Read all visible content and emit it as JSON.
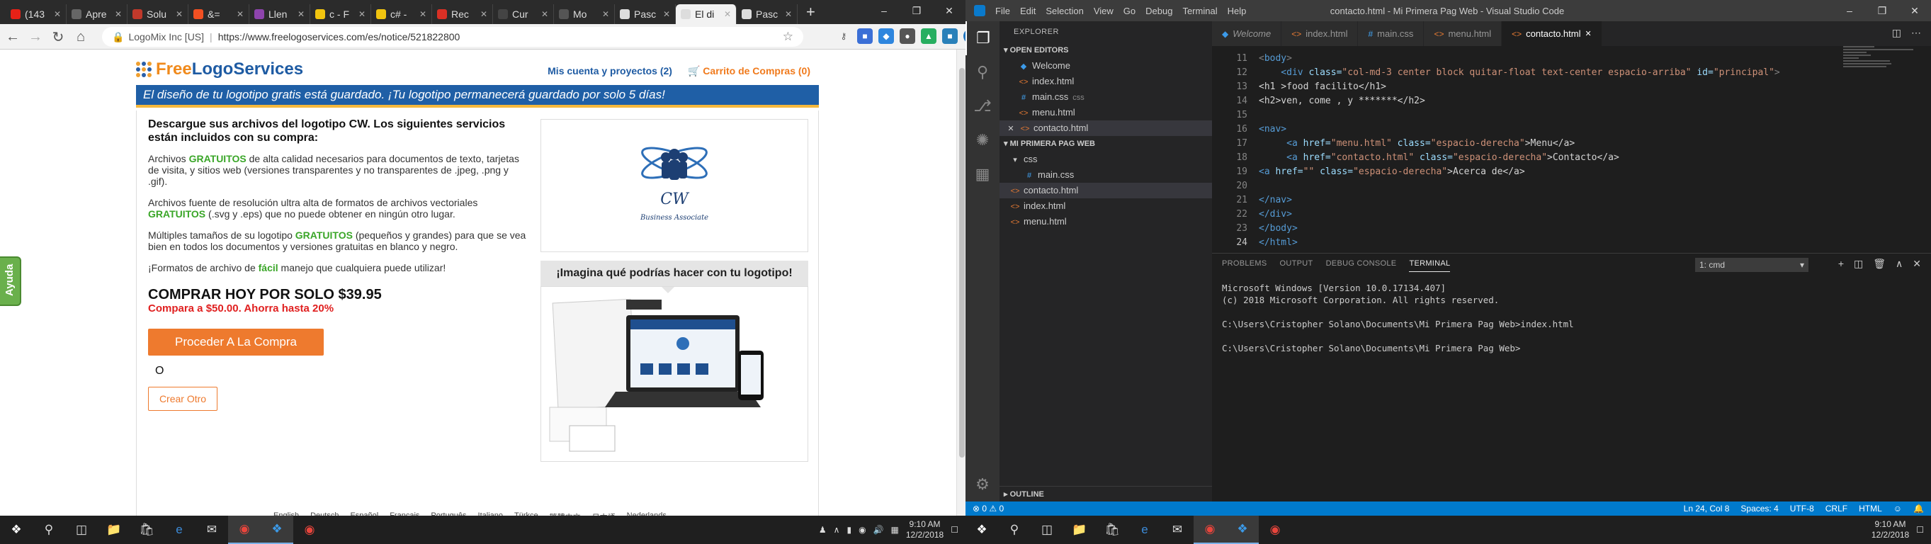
{
  "chrome": {
    "tabs": [
      {
        "label": "(143",
        "color": "#e62117"
      },
      {
        "label": "Apre",
        "color": "#666666"
      },
      {
        "label": "Solu",
        "color": "#c0392b"
      },
      {
        "label": "&=",
        "color": "#f25022"
      },
      {
        "label": "Llen",
        "color": "#8e44ad"
      },
      {
        "label": "c - F",
        "color": "#f1c40f"
      },
      {
        "label": "c# -",
        "color": "#f1c40f"
      },
      {
        "label": "Rec",
        "color": "#d93025"
      },
      {
        "label": "Cur",
        "color": "#444444"
      },
      {
        "label": "Mo ",
        "color": "#555555"
      },
      {
        "label": "Pasc",
        "color": "#dddddd"
      },
      {
        "label": "El di",
        "color": "#dddddd"
      },
      {
        "label": "Pasc",
        "color": "#dddddd"
      }
    ],
    "active_tab_index": 11,
    "site_identity": "LogoMix Inc [US]",
    "url": "https://www.freelogoservices.com/es/notice/521822800"
  },
  "site": {
    "logo_part1": "Free",
    "logo_part2": "LogoServices",
    "account_link": "Mis cuenta y proyectos (2)",
    "cart_link": "Carrito de Compras (0)",
    "banner": "El diseño de tu logotipo gratis está guardado. ¡Tu logotipo permanecerá guardado por solo 5 días!",
    "heading": "Descargue sus archivos del logotipo CW. Los siguientes servicios están incluidos con su compra:",
    "p1_a": "Archivos ",
    "p1_b": "GRATUITOS",
    "p1_c": " de alta calidad necesarios para documentos de texto, tarjetas de visita, y sitios web (versiones transparentes y no transparentes de .jpeg, .png y .gif).",
    "p2_a": "Archivos fuente de resolución ultra alta de formatos de archivos vectoriales ",
    "p2_b": "GRATUITOS",
    "p2_c": " (.svg y .eps) que no puede obtener en ningún otro lugar.",
    "p3_a": "Múltiples tamaños de su logotipo ",
    "p3_b": "GRATUITOS",
    "p3_c": " (pequeños y grandes) para que se vea bien en todos los documentos y versiones gratuitas en blanco y negro.",
    "p4_a": "¡Formatos de archivo de ",
    "p4_b": "fácil",
    "p4_c": " manejo que cualquiera puede utilizar!",
    "buy_title": "COMPRAR HOY POR SOLO $39.95",
    "compare": "Compara a $50.00. Ahorra hasta 20%",
    "proceed_button": "Proceder A La Compra",
    "or_text": "O",
    "create_button": "Crear Otro",
    "logo_initials": "CW",
    "logo_subtitle": "Business Associate",
    "imagine_heading": "¡Imagina qué podrías hacer con tu logotipo!",
    "help_tab": "Ayuda",
    "languages": [
      "English",
      "Deutsch",
      "Español",
      "Français",
      "Português",
      "Italiano",
      "Türkçe",
      "繁體中文",
      "日本語",
      "Nederlands"
    ]
  },
  "taskbar_left": {
    "time": "9:10 AM",
    "date": "12/2/2018"
  },
  "vscode": {
    "menus": [
      "File",
      "Edit",
      "Selection",
      "View",
      "Go",
      "Debug",
      "Terminal",
      "Help"
    ],
    "window_title": "contacto.html - Mi Primera Pag Web - Visual Studio Code",
    "explorer_title": "EXPLORER",
    "open_editors_title": "OPEN EDITORS",
    "open_editors": [
      {
        "name": "Welcome",
        "icon": "vscode-icon",
        "extra": ""
      },
      {
        "name": "index.html",
        "icon": "html-icon",
        "extra": ""
      },
      {
        "name": "main.css",
        "icon": "css-icon",
        "extra": "css"
      },
      {
        "name": "menu.html",
        "icon": "html-icon",
        "extra": ""
      },
      {
        "name": "contacto.html",
        "icon": "html-icon",
        "extra": ""
      }
    ],
    "project_title": "MI PRIMERA PAG WEB",
    "folder": "css",
    "folder_file": "main.css",
    "project_files": [
      "contacto.html",
      "index.html",
      "menu.html"
    ],
    "outline_title": "OUTLINE",
    "editor_tabs": [
      {
        "label": "Welcome",
        "icon": "vscode-icon"
      },
      {
        "label": "index.html",
        "icon": "html-icon"
      },
      {
        "label": "main.css",
        "icon": "css-icon"
      },
      {
        "label": "menu.html",
        "icon": "html-icon"
      },
      {
        "label": "contacto.html",
        "icon": "html-icon"
      }
    ],
    "line_numbers": [
      "11",
      "12",
      "13",
      "14",
      "15",
      "16",
      "17",
      "18",
      "19",
      "20",
      "21",
      "22",
      "23",
      "24"
    ],
    "code": {
      "l11": "<body>",
      "l12_a": "    <div ",
      "l12_b": "class=",
      "l12_c": "\"col-md-3 center block quitar-float text-center espacio-arriba\"",
      "l12_d": " id=",
      "l12_e": "\"principal\"",
      "l12_f": ">",
      "l13": "<h1 >food facilito</h1>",
      "l14": "<h2>ven, come , y *******</h2>",
      "l16": "<nav>",
      "l17_a": "     <a ",
      "l17_b": "href=",
      "l17_c": "\"menu.html\"",
      "l17_d": " class=",
      "l17_e": "\"espacio-derecha\"",
      "l17_f": ">Menu</a>",
      "l18_a": "     <a ",
      "l18_b": "href=",
      "l18_c": "\"contacto.html\"",
      "l18_d": " class=",
      "l18_e": "\"espacio-derecha\"",
      "l18_f": ">Contacto</a>",
      "l19_a": "<a ",
      "l19_b": "href=",
      "l19_c": "\"\"",
      "l19_d": " class=",
      "l19_e": "\"espacio-derecha\"",
      "l19_f": ">Acerca de</a>",
      "l21": "</nav>",
      "l22": "</div>",
      "l23": "</body>",
      "l24": "</html>"
    },
    "panel_tabs": [
      "PROBLEMS",
      "OUTPUT",
      "DEBUG CONSOLE",
      "TERMINAL"
    ],
    "terminal_select": "1: cmd",
    "terminal_lines": [
      "Microsoft Windows [Version 10.0.17134.407]",
      "(c) 2018 Microsoft Corporation. All rights reserved.",
      "",
      "C:\\Users\\Cristopher Solano\\Documents\\Mi Primera Pag Web>index.html",
      "",
      "C:\\Users\\Cristopher Solano\\Documents\\Mi Primera Pag Web>"
    ],
    "status_left": "⊗ 0 ⚠ 0",
    "status_position": "Ln 24, Col 8",
    "status_spaces": "Spaces: 4",
    "status_encoding": "UTF-8",
    "status_eol": "CRLF",
    "status_lang": "HTML",
    "accent": "#007acc"
  },
  "taskbar_right": {
    "time": "9:10 AM",
    "date": "12/2/2018"
  }
}
